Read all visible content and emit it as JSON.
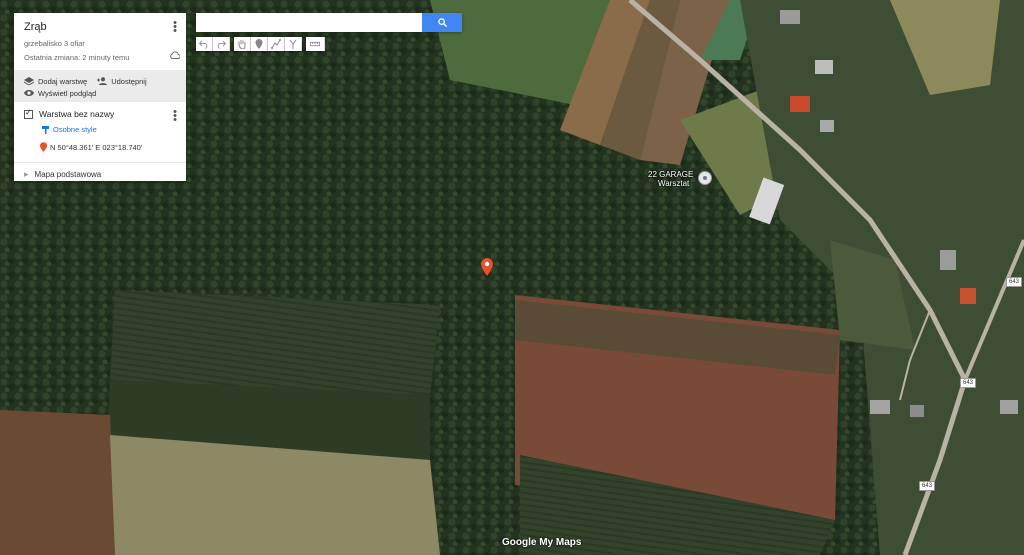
{
  "panel": {
    "title": "Zrąb",
    "description": "grzebalisko 3 ofiar",
    "last_change": "Ostatnia zmiana: 2 minuty temu",
    "add_layer": "Dodaj warstwę",
    "share": "Udostępnij",
    "preview": "Wyświetl podgląd",
    "layer_name": "Warstwa bez nazwy",
    "custom_style": "Osobne style",
    "marker_coords": "N 50°48.361' E 023°18.740'",
    "base_map": "Mapa podstawowa"
  },
  "search": {
    "placeholder": "",
    "value": ""
  },
  "toolbar": {
    "tools": [
      "undo-icon",
      "redo-icon",
      "hand-icon",
      "marker-icon",
      "line-icon",
      "directions-icon",
      "ruler-icon"
    ]
  },
  "map": {
    "poi_label_line1": "22 GARAGE",
    "poi_label_line2": "Warsztat",
    "road_number": "643",
    "brand": "Google My Maps",
    "pin_color": "#e8502a"
  },
  "colors": {
    "accent": "#4285f4",
    "link": "#1a73e8"
  }
}
